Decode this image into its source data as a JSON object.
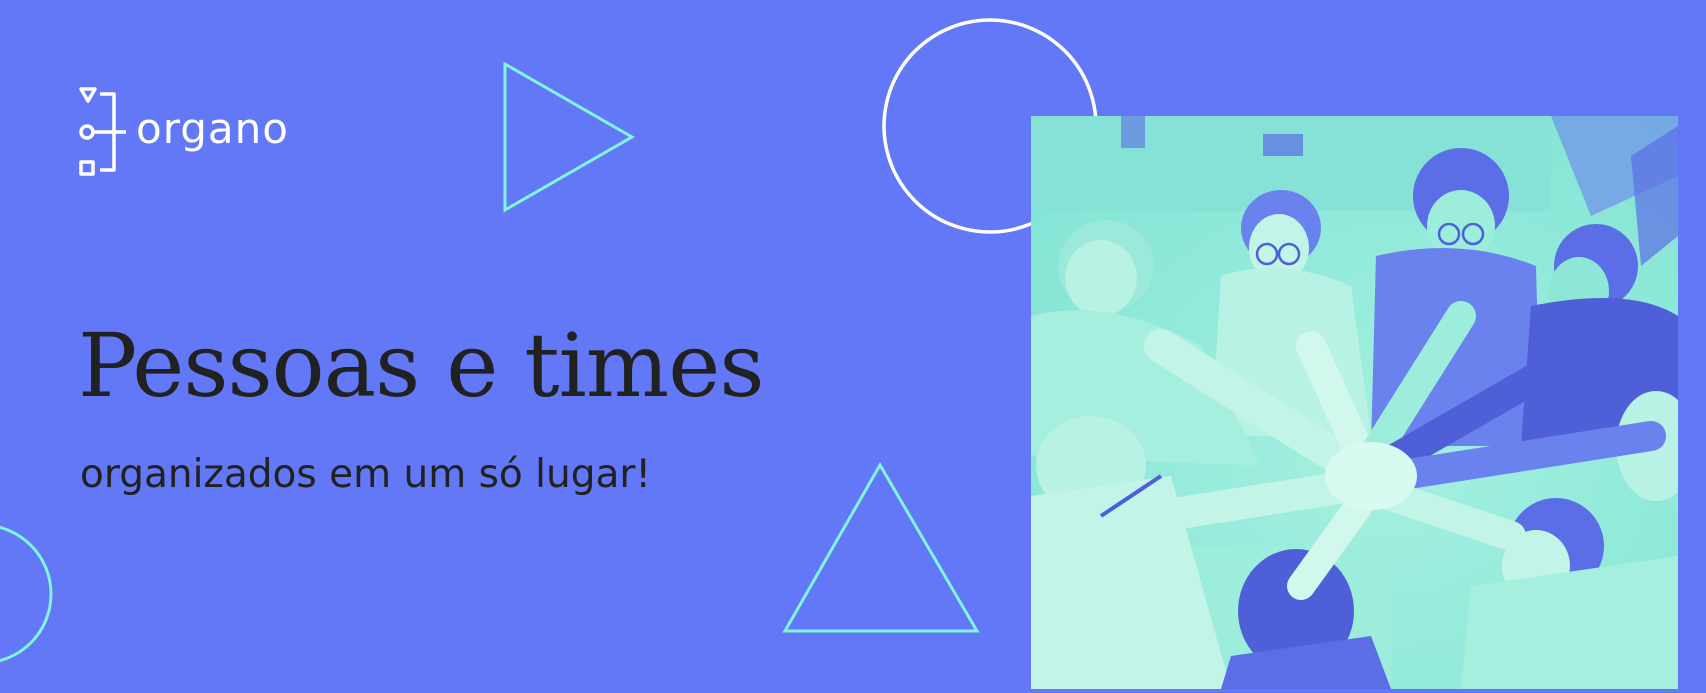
{
  "brand": {
    "logo_text": "organo",
    "logo_mark_icon": "organo-logo-mark-icon"
  },
  "hero": {
    "headline": "Pessoas e times",
    "subheadline": "organizados em um só lugar!"
  },
  "image": {
    "subject": "team-hands-together-photo"
  },
  "colors": {
    "background": "#6278F7",
    "accent_line": "#7FF5E0",
    "white_line": "#FFFFFF",
    "text_dark": "#212121",
    "photo_tint_light": "#8DEAD8",
    "photo_tint_dark": "#5B6EE6"
  }
}
